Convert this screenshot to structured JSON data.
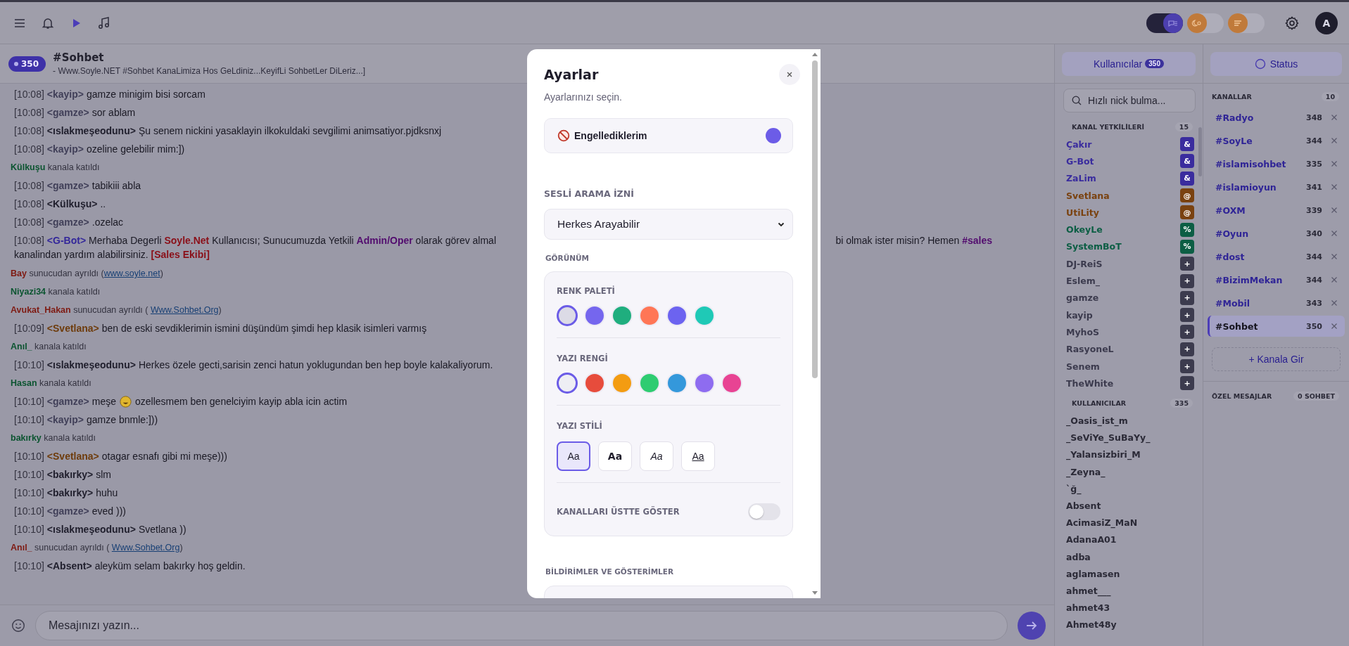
{
  "topbar": {
    "toggles": [
      {
        "on": true
      },
      {
        "on": false
      },
      {
        "on": false
      }
    ],
    "avatar": "A"
  },
  "channel_header": {
    "count": "350",
    "title": "#Sohbet",
    "topic": "- Www.Soyle.NET #Sohbet KanaLimiza Hos GeLdiniz...KeyifLi SohbetLer DiLeriz...]"
  },
  "messages": [
    {
      "kind": "message",
      "time": "[10:08]",
      "nick": "<kayip>",
      "color": "#403f58",
      "parts": [
        {
          "kind": "plain",
          "text": "gamze minigim bisi sorcam"
        }
      ]
    },
    {
      "kind": "message",
      "time": "[10:08]",
      "nick": "<gamze>",
      "color": "#403f58",
      "parts": [
        {
          "kind": "plain",
          "text": "sor ablam"
        }
      ]
    },
    {
      "kind": "message",
      "time": "[10:08]",
      "nick": "<ıslakmeşeodunu>",
      "color": "#1f1e2c",
      "parts": [
        {
          "kind": "plain",
          "text": "Şu senem nickini yasaklayin ilkokuldaki sevgilimi animsatiyor.pjdksnxj"
        }
      ]
    },
    {
      "kind": "message",
      "time": "[10:08]",
      "nick": "<kayip>",
      "color": "#403f58",
      "parts": [
        {
          "kind": "plain",
          "text": "ozeline gelebilir mim:])"
        }
      ]
    },
    {
      "kind": "join",
      "nick": "Külkuşu",
      "text": "kanala katıldı"
    },
    {
      "kind": "message",
      "time": "[10:08]",
      "nick": "<gamze>",
      "color": "#403f58",
      "parts": [
        {
          "kind": "plain",
          "text": "tabikiii abla"
        }
      ]
    },
    {
      "kind": "message",
      "time": "[10:08]",
      "nick": "<Külkuşu>",
      "color": "#1f1e2c",
      "parts": [
        {
          "kind": "plain",
          "text": ".."
        }
      ]
    },
    {
      "kind": "message",
      "time": "[10:08]",
      "nick": "<gamze>",
      "color": "#403f58",
      "parts": [
        {
          "kind": "plain",
          "text": ".ozelac"
        }
      ]
    },
    {
      "kind": "message",
      "time": "[10:08]",
      "nick": "<G-Bot>",
      "color": "#33279a",
      "parts": [
        {
          "kind": "plain",
          "text": "Merhaba Degerli "
        },
        {
          "kind": "red",
          "text": "Soyle.Net"
        },
        {
          "kind": "plain",
          "text": " Kullanıcısı; Sunucumuzda Yetkili "
        },
        {
          "kind": "purple",
          "text": "Admin/Oper"
        },
        {
          "kind": "plain",
          "text": " olarak görev almal"
        }
      ],
      "after_gap": [
        {
          "kind": "plain",
          "text": "bi olmak ister misin? Hemen "
        },
        {
          "kind": "purple",
          "text": "#sales"
        }
      ],
      "next_line": [
        {
          "kind": "plain",
          "text": "kanalindan yardım alabilirsiniz. "
        },
        {
          "kind": "red",
          "text": "[Sales Ekibi]"
        }
      ]
    },
    {
      "kind": "part",
      "nick": "Bay",
      "text": "sunucudan ayrıldı (",
      "link": "www.soyle.net",
      "end": ")"
    },
    {
      "kind": "join",
      "nick": "Niyazi34",
      "text": "kanala katıldı"
    },
    {
      "kind": "part",
      "nick": "Avukat_Hakan",
      "text": "sunucudan ayrıldı ( ",
      "link": "Www.Sohbet.Org",
      "end": ")"
    },
    {
      "kind": "message",
      "time": "[10:09]",
      "nick": "<Svetlana>",
      "color": "#6e3c0c",
      "parts": [
        {
          "kind": "plain",
          "text": "ben de eski sevdiklerimin ismini düşündüm şimdi hep klasik isimleri varmış"
        }
      ]
    },
    {
      "kind": "join",
      "nick": "Anıl_",
      "text": "kanala katıldı"
    },
    {
      "kind": "message",
      "time": "[10:10]",
      "nick": "<ıslakmeşeodunu>",
      "color": "#1f1e2c",
      "parts": [
        {
          "kind": "plain",
          "text": "Herkes özele gecti,sarisin zenci hatun yoklugundan ben hep boyle kalakaliyorum."
        }
      ]
    },
    {
      "kind": "join",
      "nick": "Hasan",
      "text": "kanala katıldı"
    },
    {
      "kind": "message",
      "time": "[10:10]",
      "nick": "<gamze>",
      "color": "#403f58",
      "parts": [
        {
          "kind": "plain",
          "text": "meşe"
        },
        {
          "kind": "emoji"
        },
        {
          "kind": "plain",
          "text": "ozellesmem ben genelciyim kayip abla icin actim"
        }
      ]
    },
    {
      "kind": "message",
      "time": "[10:10]",
      "nick": "<kayip>",
      "color": "#403f58",
      "parts": [
        {
          "kind": "plain",
          "text": "gamze bnmle:]))"
        }
      ]
    },
    {
      "kind": "join",
      "nick": "bakırky",
      "text": "kanala katıldı"
    },
    {
      "kind": "message",
      "time": "[10:10]",
      "nick": "<Svetlana>",
      "color": "#6e3c0c",
      "parts": [
        {
          "kind": "plain",
          "text": "otagar esnafı gibi mi meşe)))"
        }
      ]
    },
    {
      "kind": "message",
      "time": "[10:10]",
      "nick": "<bakırky>",
      "color": "#1f1e2c",
      "parts": [
        {
          "kind": "plain",
          "text": "slm"
        }
      ]
    },
    {
      "kind": "message",
      "time": "[10:10]",
      "nick": "<bakırky>",
      "color": "#1f1e2c",
      "parts": [
        {
          "kind": "plain",
          "text": "huhu"
        }
      ]
    },
    {
      "kind": "message",
      "time": "[10:10]",
      "nick": "<gamze>",
      "color": "#403f58",
      "parts": [
        {
          "kind": "plain",
          "text": "eved )))"
        }
      ]
    },
    {
      "kind": "message",
      "time": "[10:10]",
      "nick": "<ıslakmeşeodunu>",
      "color": "#1f1e2c",
      "parts": [
        {
          "kind": "plain",
          "text": "Svetlana ))"
        }
      ]
    },
    {
      "kind": "part",
      "nick": "Anıl_",
      "text": "sunucudan ayrıldı ( ",
      "link": "Www.Sohbet.Org",
      "end": ")"
    },
    {
      "kind": "message",
      "time": "[10:10]",
      "nick": "<Absent>",
      "color": "#1f1e2c",
      "parts": [
        {
          "kind": "plain",
          "text": "aleyküm selam bakırky hoş geldin."
        }
      ]
    }
  ],
  "composer": {
    "placeholder": "Mesajınızı yazın..."
  },
  "users_panel": {
    "tab": "Kullanıcılar",
    "count": "350",
    "search_placeholder": "Hızlı nick bulma...",
    "operators": {
      "title": "KANAL YETKİLİLERİ",
      "count": "15",
      "items": [
        {
          "name": "Çakır",
          "mode": "&",
          "color": "#3a2c9e"
        },
        {
          "name": "G-Bot",
          "mode": "&",
          "color": "#3a2c9e"
        },
        {
          "name": "ZaLim",
          "mode": "&",
          "color": "#3a2c9e"
        },
        {
          "name": "Svetlana",
          "mode": "@",
          "color": "#7a4210"
        },
        {
          "name": "UtiLity",
          "mode": "@",
          "color": "#7a4210"
        },
        {
          "name": "OkeyLe",
          "mode": "%",
          "color": "#0c5e44"
        },
        {
          "name": "SystemBoT",
          "mode": "%",
          "color": "#0c5e44"
        },
        {
          "name": "DJ-ReiS",
          "mode": "+",
          "color": "#3c3b4e"
        },
        {
          "name": "Eslem_",
          "mode": "+",
          "color": "#3c3b4e"
        },
        {
          "name": "gamze",
          "mode": "+",
          "color": "#3c3b4e"
        },
        {
          "name": "kayip",
          "mode": "+",
          "color": "#3c3b4e"
        },
        {
          "name": "MyhoS",
          "mode": "+",
          "color": "#3c3b4e"
        },
        {
          "name": "RasyoneL",
          "mode": "+",
          "color": "#3c3b4e"
        },
        {
          "name": "Senem",
          "mode": "+",
          "color": "#3c3b4e"
        },
        {
          "name": "TheWhite",
          "mode": "+",
          "color": "#3c3b4e"
        }
      ]
    },
    "users": {
      "title": "KULLANICILAR",
      "count": "335",
      "items": [
        "_Oasis_ist_m",
        "_SeViYe_SuBaYy_",
        "_Yalansizbiri_M",
        "_Zeyna_",
        "`ğ_",
        "Absent",
        "AcimasiZ_MaN",
        "AdanaA01",
        "adba",
        "aglamasen",
        "ahmet___",
        "ahmet43",
        "Ahmet48y"
      ]
    }
  },
  "channels_panel": {
    "status": "Status",
    "title": "KANALLAR",
    "count": "10",
    "items": [
      {
        "name": "#Radyo",
        "count": "348",
        "selected": false
      },
      {
        "name": "#SoyLe",
        "count": "344",
        "selected": false
      },
      {
        "name": "#islamisohbet",
        "count": "335",
        "selected": false
      },
      {
        "name": "#islamioyun",
        "count": "341",
        "selected": false
      },
      {
        "name": "#OXM",
        "count": "339",
        "selected": false
      },
      {
        "name": "#Oyun",
        "count": "340",
        "selected": false
      },
      {
        "name": "#dost",
        "count": "344",
        "selected": false
      },
      {
        "name": "#BizimMekan",
        "count": "344",
        "selected": false
      },
      {
        "name": "#Mobil",
        "count": "343",
        "selected": false
      },
      {
        "name": "#Sohbet",
        "count": "350",
        "selected": true
      }
    ],
    "join_button": "+ Kanala Gir",
    "private": {
      "title": "ÖZEL MESAJLAR",
      "count": "0 SOHBET"
    }
  },
  "modal": {
    "title": "Ayarlar",
    "subtitle": "Ayarlarınızı seçin.",
    "blocked": {
      "label": "Engellediklerim"
    },
    "call_permission": {
      "label": "SESLİ ARAMA İZNİ",
      "value": "Herkes Arayabilir"
    },
    "appearance": {
      "title": "GÖRÜNÜM",
      "palette": {
        "label": "RENK PALETİ",
        "swatches": [
          {
            "color": "#dcdbe6",
            "selected": true
          },
          {
            "color": "#7566ee",
            "selected": false
          },
          {
            "color": "#1fae7e",
            "selected": false
          },
          {
            "color": "#ff7656",
            "selected": false
          },
          {
            "color": "#6c63f0",
            "selected": false
          },
          {
            "color": "#1fc9b6",
            "selected": false
          }
        ]
      },
      "text_color": {
        "label": "YAZI RENGİ",
        "swatches": [
          {
            "color": "#eeeef4",
            "selected": true
          },
          {
            "color": "#e74c3c",
            "selected": false
          },
          {
            "color": "#f39c12",
            "selected": false
          },
          {
            "color": "#2ecc71",
            "selected": false
          },
          {
            "color": "#3498db",
            "selected": false
          },
          {
            "color": "#8e6cf0",
            "selected": false
          },
          {
            "color": "#e84393",
            "selected": false
          }
        ]
      },
      "text_style": {
        "label": "YAZI STİLİ",
        "options": [
          {
            "label": "Aa",
            "kind": "normal",
            "selected": true
          },
          {
            "label": "Aa",
            "kind": "bold",
            "selected": false
          },
          {
            "label": "Aa",
            "kind": "italic",
            "selected": false
          },
          {
            "label": "Aa",
            "kind": "underline",
            "selected": false
          }
        ]
      },
      "channels_on_top": {
        "label": "KANALLARI ÜSTTE GÖSTER",
        "on": false
      }
    },
    "notifications": {
      "title": "BİLDİRİMLER VE GÖSTERİMLER"
    }
  }
}
